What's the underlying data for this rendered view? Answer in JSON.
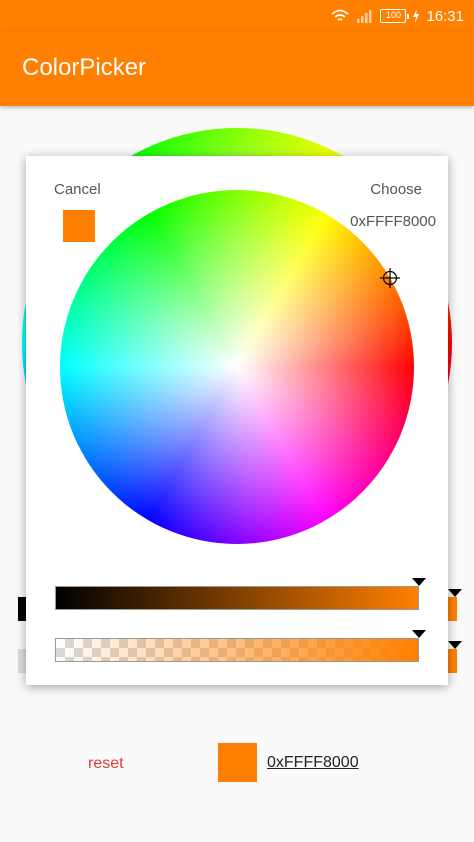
{
  "status_bar": {
    "time": "16:31",
    "battery": "100",
    "icons": [
      "wifi-icon",
      "signal-icon",
      "battery-icon",
      "charging-icon"
    ]
  },
  "app_bar": {
    "title": "ColorPicker",
    "color": "#ff8000"
  },
  "dialog": {
    "cancel_label": "Cancel",
    "choose_label": "Choose",
    "hex_value": "0xFFFF8000",
    "selected_color": "#ff8000"
  },
  "footer": {
    "reset_label": "reset",
    "hex_value": "0xFFFF8000",
    "color": "#ff8000"
  }
}
